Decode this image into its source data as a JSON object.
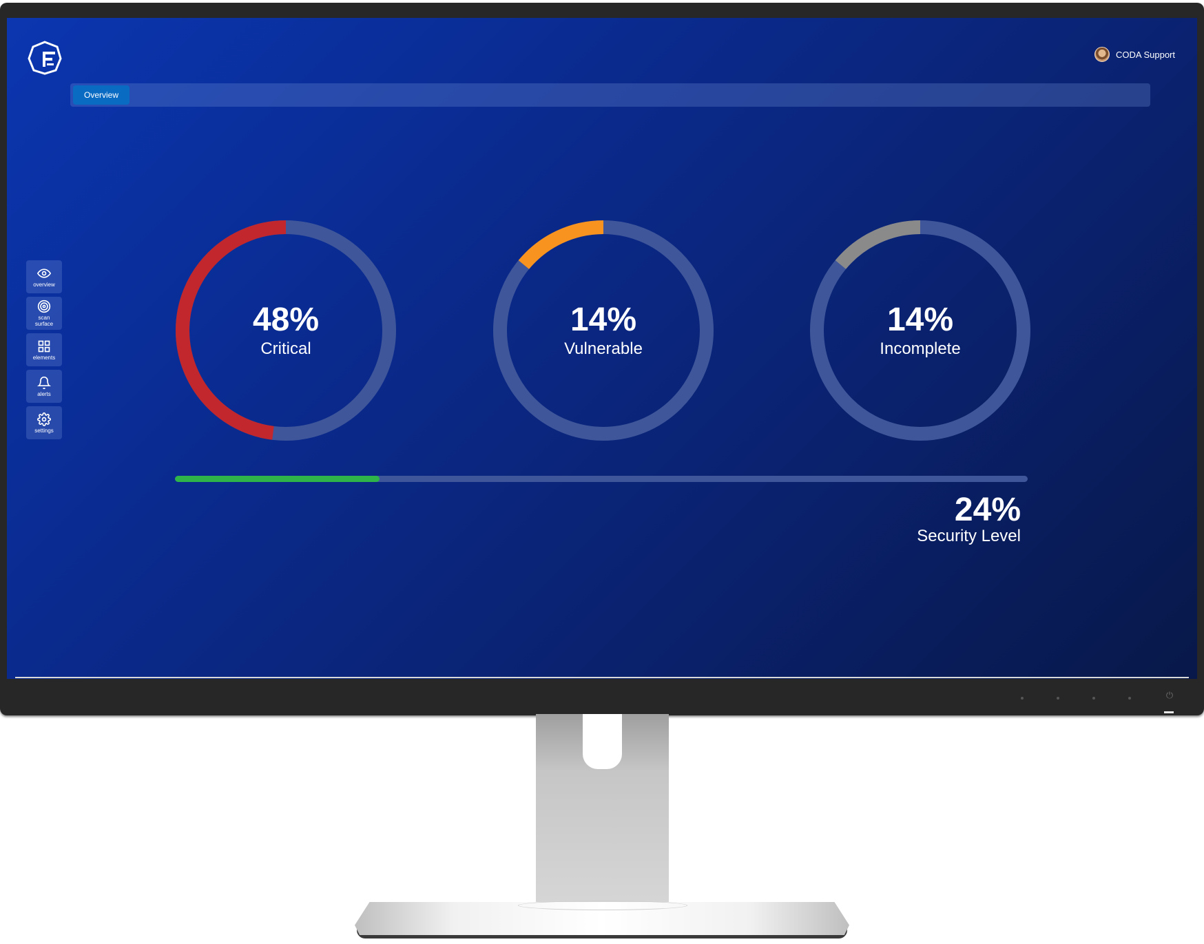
{
  "header": {
    "user_name": "CODA Support"
  },
  "tabs": [
    {
      "label": "Overview",
      "active": true
    }
  ],
  "sidebar": {
    "items": [
      {
        "label": "overview",
        "icon": "eye-icon"
      },
      {
        "label": "scan\nsurface",
        "icon": "target-icon"
      },
      {
        "label": "elements",
        "icon": "grid-icon"
      },
      {
        "label": "alerts",
        "icon": "bell-icon"
      },
      {
        "label": "settings",
        "icon": "gear-icon"
      }
    ]
  },
  "gauges": [
    {
      "value": "48%",
      "label": "Critical",
      "percent": 48,
      "color": "#c1272d"
    },
    {
      "value": "14%",
      "label": "Vulnerable",
      "percent": 14,
      "color": "#f7931e"
    },
    {
      "value": "14%",
      "label": "Incomplete",
      "percent": 14,
      "color": "#8a8a8a"
    }
  ],
  "security": {
    "value": "24%",
    "label": "Security Level",
    "percent": 24,
    "color": "#2fb44a"
  },
  "colors": {
    "track": "#3f579a",
    "accent": "#0a6bc3"
  }
}
